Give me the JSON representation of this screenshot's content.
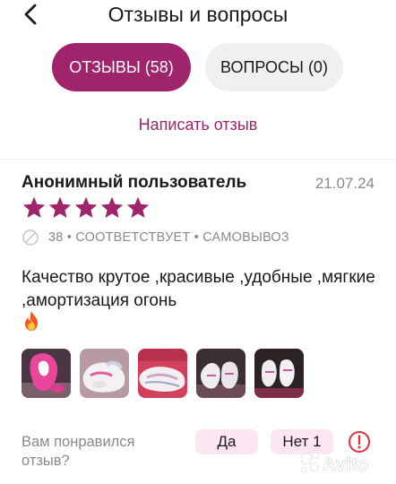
{
  "header": {
    "title": "Отзывы и вопросы",
    "back_icon": "chevron-left-icon"
  },
  "tabs": [
    {
      "label": "ОТЗЫВЫ (58)",
      "active": true
    },
    {
      "label": "ВОПРОСЫ (0)",
      "active": false
    }
  ],
  "write_review": "Написать отзыв",
  "review": {
    "author": "Анонимный пользователь",
    "date": "21.07.24",
    "rating": 5,
    "meta": "38 • СООТВЕТСТВУЕТ • САМОВЫВОЗ",
    "text": "Качество крутое ,красивые ,удобные ,мягкие ,амортизация огонь",
    "emoji": "fire-emoji",
    "photo_count": 5
  },
  "helpful": {
    "question": "Вам понравился отзыв?",
    "yes_label": "Да",
    "no_label": "Нет 1"
  },
  "watermark": "Avito",
  "colors": {
    "accent": "#a0246b",
    "vote_bg": "#fbe6f2",
    "tab_inactive_bg": "#f1f0f1",
    "muted": "#8a8a8a"
  }
}
